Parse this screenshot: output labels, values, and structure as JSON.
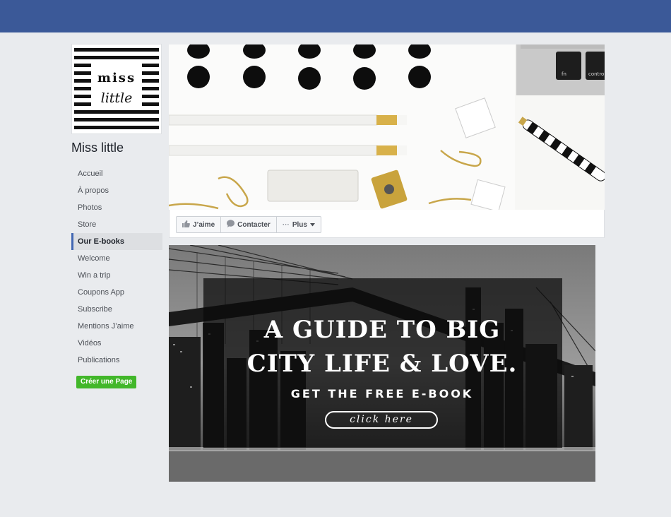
{
  "page": {
    "name": "Miss little",
    "logo_text": [
      "miss",
      "little"
    ]
  },
  "sidebar": {
    "items": [
      {
        "label": "Accueil",
        "active": false
      },
      {
        "label": "À propos",
        "active": false
      },
      {
        "label": "Photos",
        "active": false
      },
      {
        "label": "Store",
        "active": false
      },
      {
        "label": "Our E-books",
        "active": true
      },
      {
        "label": "Welcome",
        "active": false
      },
      {
        "label": "Win a trip",
        "active": false
      },
      {
        "label": "Coupons App",
        "active": false
      },
      {
        "label": "Subscribe",
        "active": false
      },
      {
        "label": "Mentions J’aime",
        "active": false
      },
      {
        "label": "Vidéos",
        "active": false
      },
      {
        "label": "Publications",
        "active": false
      }
    ],
    "create_page_label": "Créer une Page"
  },
  "actions": {
    "like_label": "J’aime",
    "contact_label": "Contacter",
    "more_label": "Plus"
  },
  "cover": {
    "key_fn": "fn",
    "key_control": "control"
  },
  "banner": {
    "headline_line1": "A GUIDE TO BIG",
    "headline_line2": "CITY LIFE & LOVE.",
    "subheadline": "GET THE FREE E-BOOK",
    "cta_label": "click here"
  },
  "colors": {
    "topbar": "#3b5998",
    "background": "#e9ebee",
    "create_button": "#42b72a",
    "active_indicator": "#4267b2"
  }
}
